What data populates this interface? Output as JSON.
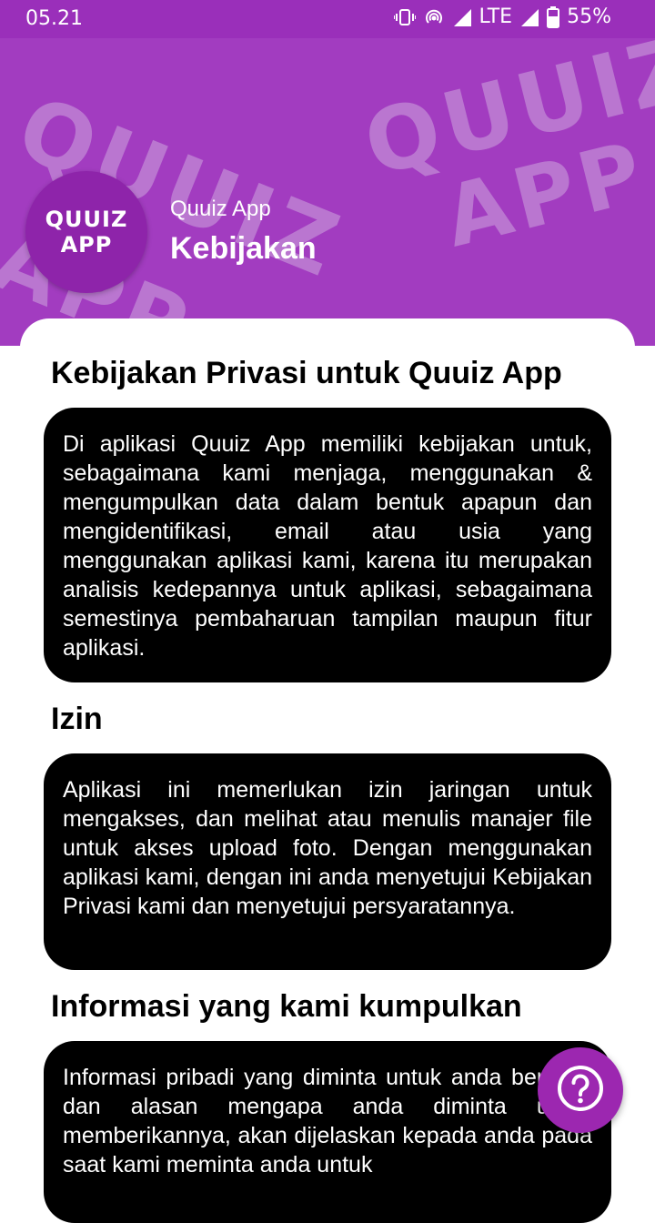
{
  "status_bar": {
    "time": "05.21",
    "network": "LTE",
    "battery": "55%"
  },
  "header": {
    "logo_line1": "QUUIZ",
    "logo_line2": "APP",
    "watermark_line1": "QUUIZ",
    "watermark_line2": "APP",
    "app_name": "Quuiz App",
    "page_title": "Kebijakan",
    "background_color": "#a23cc0"
  },
  "sections": [
    {
      "heading": "Kebijakan Privasi untuk Quuiz App",
      "body": "Di aplikasi Quuiz App memiliki kebijakan untuk, sebagaimana kami menjaga, menggunakan & mengumpulkan data dalam bentuk apapun dan mengidentifikasi, email atau usia yang menggunakan aplikasi kami, karena itu merupakan analisis kedepannya untuk aplikasi, sebagaimana semestinya pembaharuan tampilan maupun fitur aplikasi."
    },
    {
      "heading": "Izin",
      "body": "Aplikasi ini memerlukan izin jaringan untuk mengakses, dan melihat atau menulis manajer file untuk akses upload foto. Dengan menggunakan aplikasi kami, dengan ini anda menyetujui Kebijakan Privasi kami dan menyetujui persyaratannya."
    },
    {
      "heading": "Informasi yang kami kumpulkan",
      "body": "Informasi pribadi yang diminta untuk anda berikan, dan alasan mengapa anda diminta untuk memberikannya, akan dijelaskan kepada anda pada saat kami meminta anda untuk"
    }
  ],
  "fab": {
    "icon": "help-circle-icon",
    "color": "#9c27b0"
  }
}
